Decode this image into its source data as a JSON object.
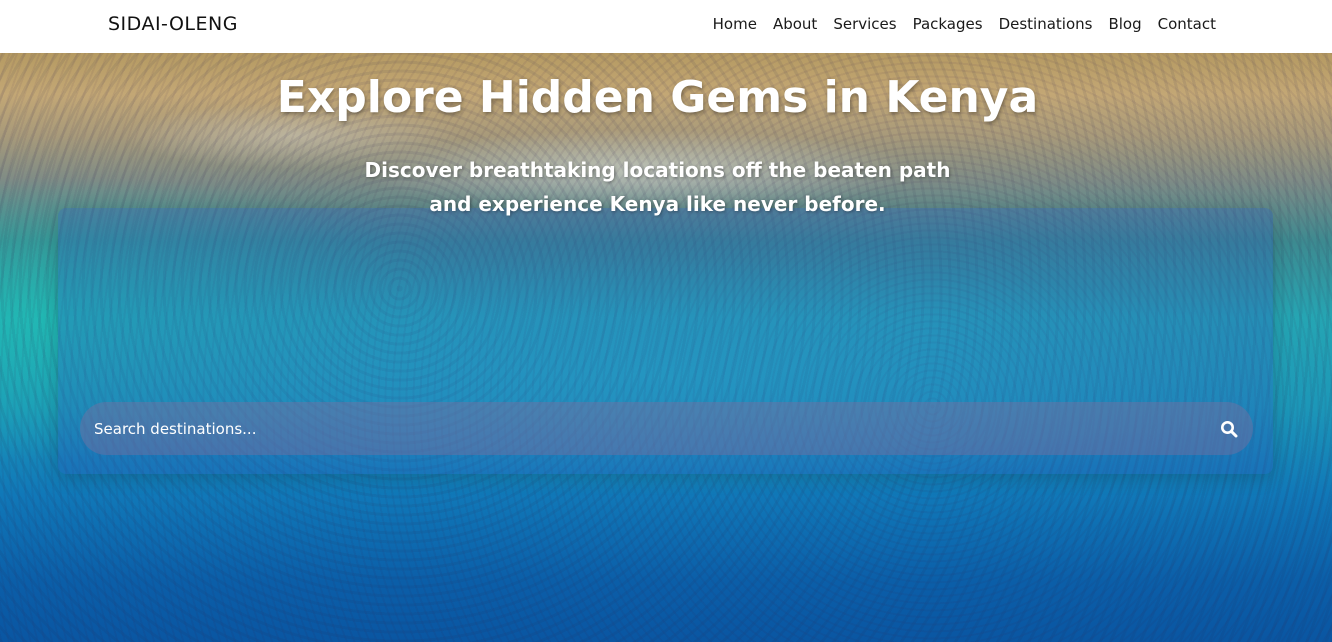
{
  "navbar": {
    "brand": "SIDAI-OLENG",
    "links": [
      "Home",
      "About",
      "Services",
      "Packages",
      "Destinations",
      "Blog",
      "Contact"
    ]
  },
  "hero": {
    "title": "Explore Hidden Gems in Kenya",
    "subtitle_line1": "Discover breathtaking locations off the beaten path",
    "subtitle_line2": "and experience Kenya like never before."
  },
  "search": {
    "placeholder": "Search destinations...",
    "icon": "search-icon"
  },
  "colors": {
    "navbar_bg": "#ffffff",
    "text_on_hero": "#ffffff",
    "ocean_blue": "#0a56a2",
    "turquoise": "#25a5b3"
  }
}
